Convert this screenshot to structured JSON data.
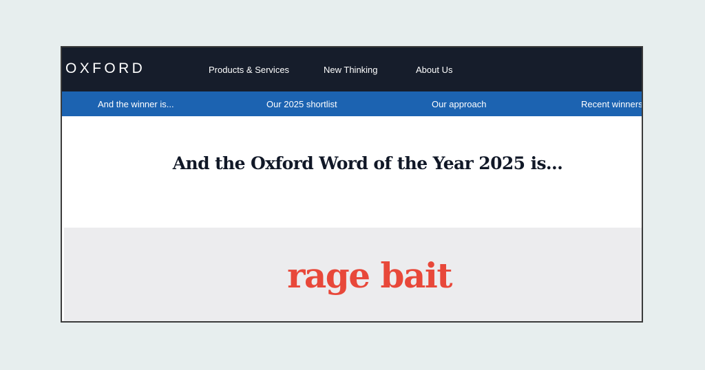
{
  "header": {
    "logo": "OXFORD",
    "nav": [
      {
        "label": "Products & Services"
      },
      {
        "label": "New Thinking"
      },
      {
        "label": "About Us"
      }
    ]
  },
  "subnav": [
    {
      "label": "And the winner is..."
    },
    {
      "label": "Our 2025 shortlist"
    },
    {
      "label": "Our approach"
    },
    {
      "label": "Recent winners"
    }
  ],
  "main": {
    "headline": "And the Oxford Word of the Year 2025 is...",
    "word_of_the_year": "rage bait"
  },
  "colors": {
    "page_background": "#e7eeee",
    "topbar": "#161d2b",
    "subnav_bar": "#1c63b1",
    "word_panel": "#ececee",
    "word_accent": "#e8483a",
    "headline_text": "#111827"
  }
}
